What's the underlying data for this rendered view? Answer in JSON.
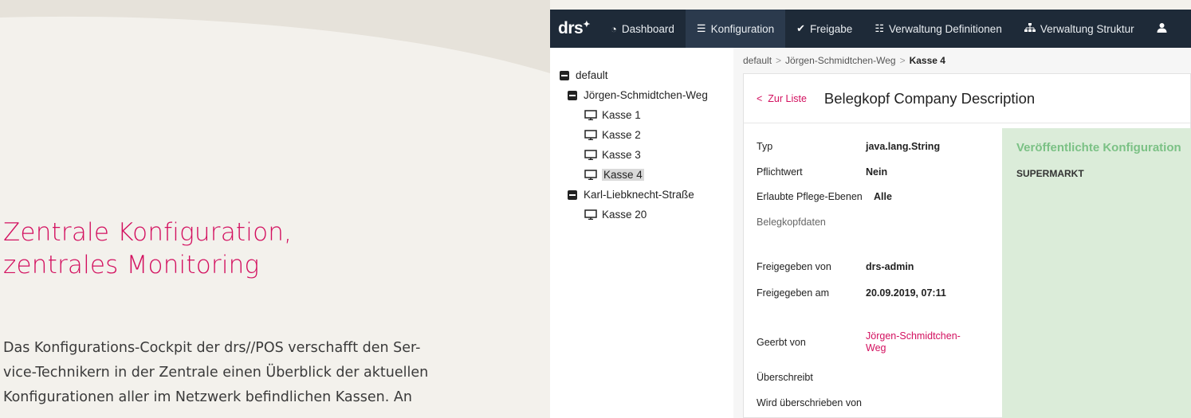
{
  "headline": {
    "line1": "Zentrale Konfiguration,",
    "line2": "zentrales Monitoring"
  },
  "intro": {
    "line1": "Das Konfigurations-Cockpit der drs//POS verschafft den Ser-",
    "line2": "vice-Technikern in der Zentrale einen Überblick der aktuellen",
    "line3": "Konfigurationen aller im Netzwerk befindlichen Kassen. An"
  },
  "app": {
    "logo": "drs",
    "nav": [
      {
        "label": "Dashboard",
        "icon": "dashboard-icon"
      },
      {
        "label": "Konfiguration",
        "icon": "sliders-icon",
        "active": true
      },
      {
        "label": "Freigabe",
        "icon": "check-icon"
      },
      {
        "label": "Verwaltung Definitionen",
        "icon": "list-icon"
      },
      {
        "label": "Verwaltung Struktur",
        "icon": "sitemap-icon"
      }
    ],
    "tree": {
      "root": "default",
      "groups": [
        {
          "label": "Jörgen-Schmidtchen-Weg",
          "items": [
            "Kasse 1",
            "Kasse 2",
            "Kasse 3",
            "Kasse 4"
          ]
        },
        {
          "label": "Karl-Liebknecht-Straße",
          "items": [
            "Kasse 20"
          ]
        }
      ],
      "selected": "Kasse 4"
    },
    "breadcrumb": [
      "default",
      "Jörgen-Schmidtchen-Weg",
      "Kasse 4"
    ],
    "detail": {
      "back_label": "Zur Liste",
      "title": "Belegkopf Company Description",
      "props": {
        "typ": {
          "k": "Typ",
          "v": "java.lang.String"
        },
        "pflicht": {
          "k": "Pflichtwert",
          "v": "Nein"
        },
        "ebenen": {
          "k": "Erlaubte Pflege-Ebenen",
          "v": "Alle"
        },
        "belegkopf": {
          "k": "Belegkopfdaten"
        },
        "freigegeben_von": {
          "k": "Freigegeben von",
          "v": "drs-admin"
        },
        "freigegeben_am": {
          "k": "Freigegeben am",
          "v": "20.09.2019, 07:11"
        },
        "geerbt": {
          "k": "Geerbt von",
          "v": "Jörgen-Schmidtchen-Weg"
        },
        "ueberschreibt": {
          "k": "Überschreibt"
        },
        "ueberschrieben": {
          "k": "Wird überschrieben von"
        }
      },
      "published": {
        "title": "Veröffentlichte Konfiguration",
        "value": "SUPERMARKT"
      }
    }
  },
  "colors": {
    "accent": "#d3105f",
    "navbar": "#1e2a38",
    "published_bg": "#dbecd9",
    "published_title": "#7bc185",
    "page_bg": "#f3f1ec"
  }
}
